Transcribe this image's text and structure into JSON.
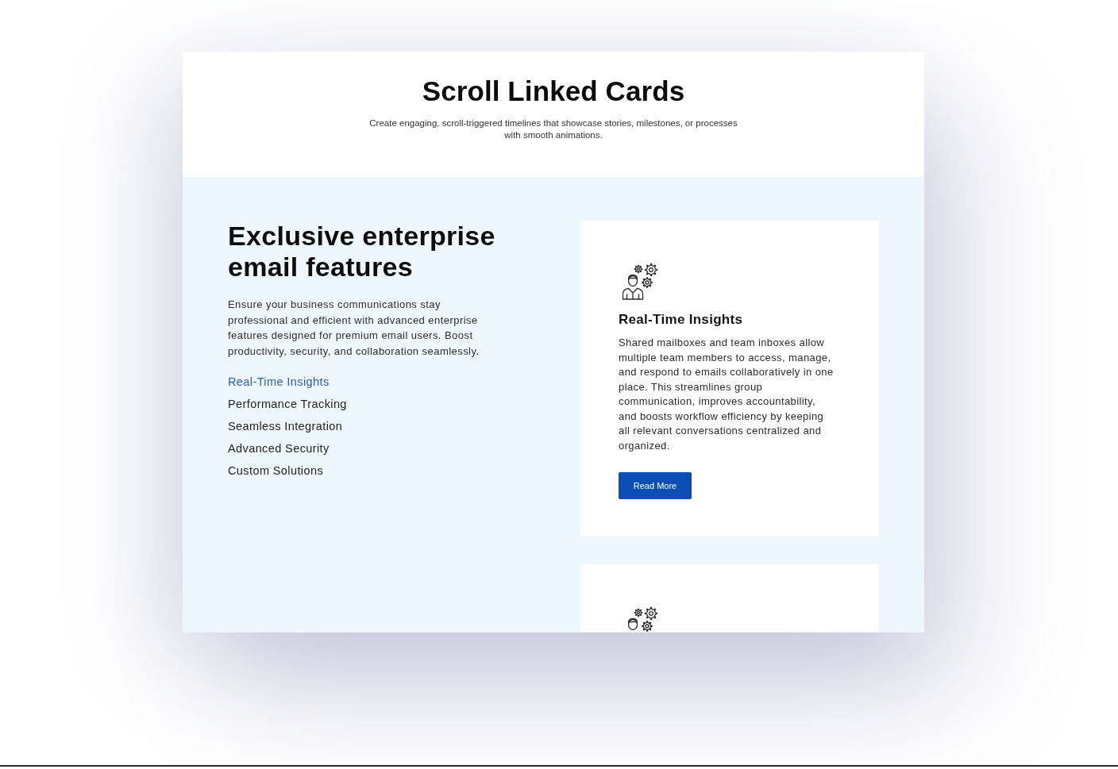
{
  "header": {
    "title": "Scroll Linked Cards",
    "subtitle": "Create engaging, scroll-triggered timelines that showcase stories, milestones, or processes with smooth animations."
  },
  "intro": {
    "heading": "Exclusive enterprise email features",
    "text": "Ensure your business communications stay professional and efficient with advanced enterprise features designed for premium email users. Boost productivity, security, and collaboration seamlessly."
  },
  "nav": [
    {
      "label": "Real-Time Insights",
      "selected": true
    },
    {
      "label": "Performance Tracking",
      "selected": false
    },
    {
      "label": "Seamless Integration",
      "selected": false
    },
    {
      "label": "Advanced Security",
      "selected": false
    },
    {
      "label": "Custom Solutions",
      "selected": false
    }
  ],
  "cards": [
    {
      "kind": "full",
      "title": "Real-Time Insights",
      "text": "Shared mailboxes and team inboxes allow multiple team members to access, manage, and respond to emails collaboratively in one place. This streamlines group communication, improves accountability, and boosts workflow efficiency by keeping all relevant conversations centralized and organized.",
      "button": "Read More"
    },
    {
      "kind": "cut_off"
    }
  ]
}
